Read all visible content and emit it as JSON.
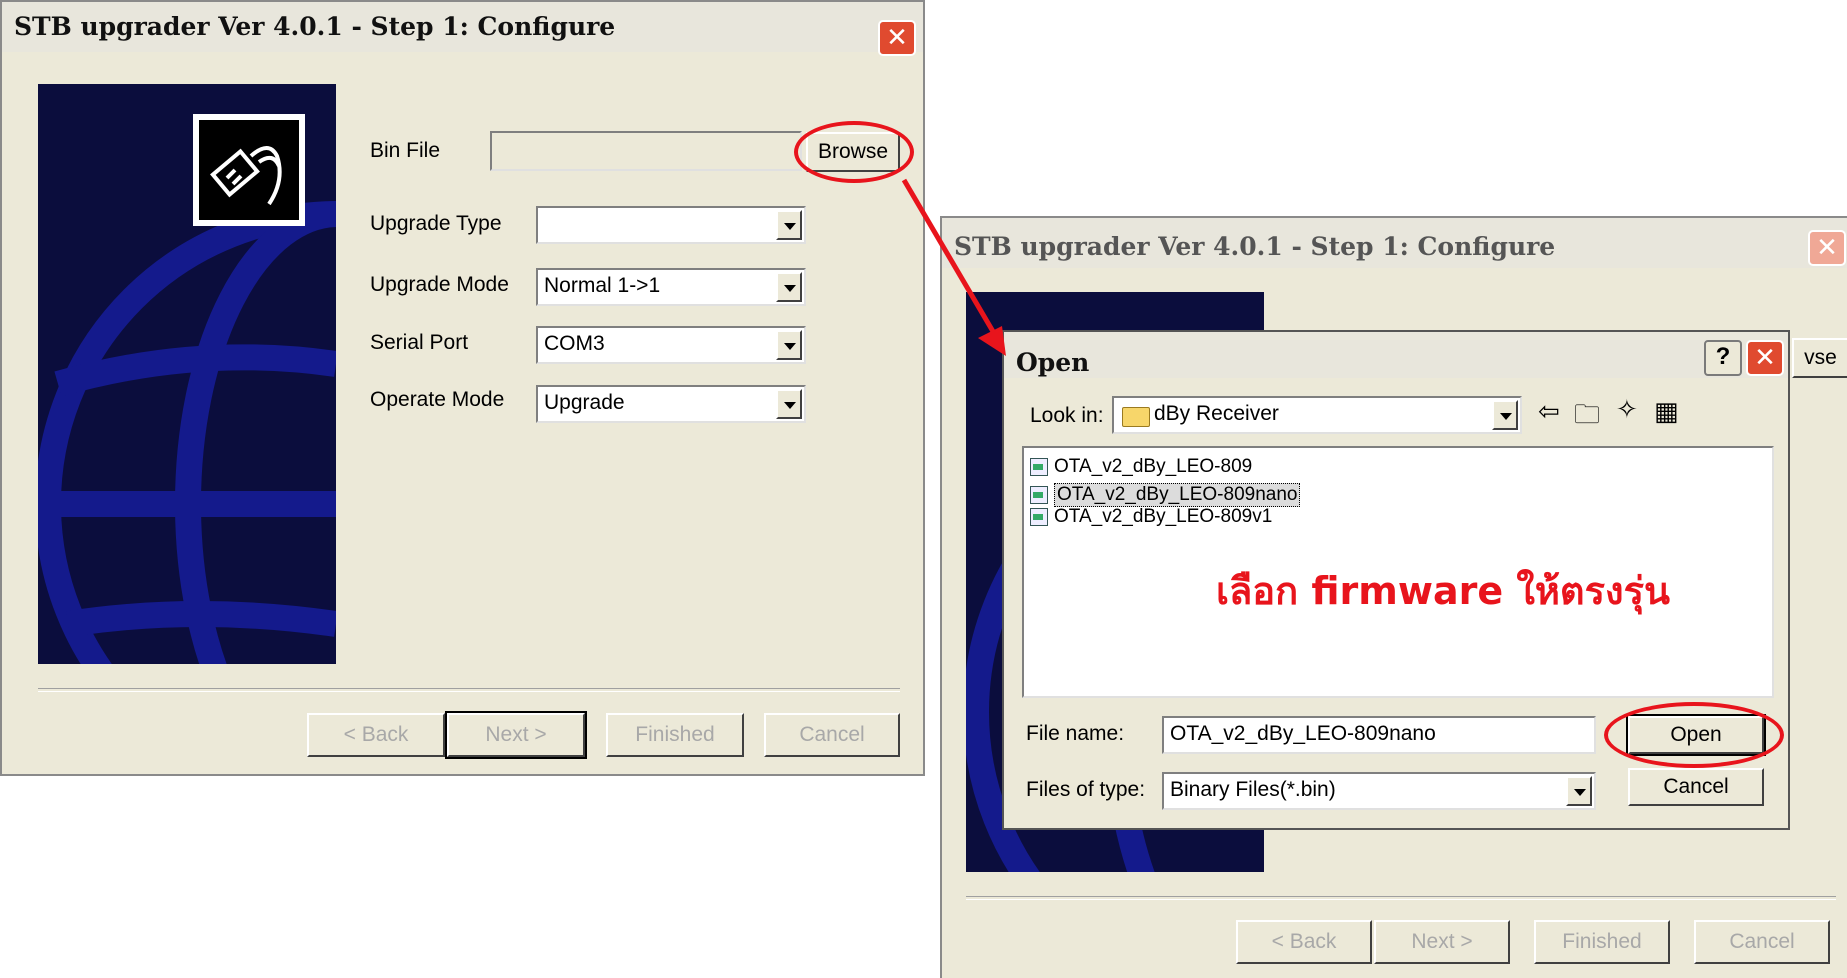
{
  "window1": {
    "title": "STB upgrader Ver 4.0.1 - Step 1: Configure",
    "close_glyph": "✕",
    "bin_file_label": "Bin File",
    "bin_file_value": "",
    "browse_label": "Browse",
    "upgrade_type_label": "Upgrade Type",
    "upgrade_type_value": "",
    "upgrade_mode_label": "Upgrade Mode",
    "upgrade_mode_value": "Normal 1->1",
    "serial_port_label": "Serial Port",
    "serial_port_value": "COM3",
    "operate_mode_label": "Operate Mode",
    "operate_mode_value": "Upgrade",
    "back_label": "< Back",
    "next_label": "Next >",
    "finished_label": "Finished",
    "cancel_label": "Cancel"
  },
  "window2": {
    "title": "STB upgrader Ver 4.0.1 - Step 1: Configure",
    "close_glyph": "✕",
    "browse_partial": "vse",
    "back_label": "< Back",
    "next_label": "Next >",
    "finished_label": "Finished",
    "cancel_label": "Cancel"
  },
  "open_dialog": {
    "title": "Open",
    "help_glyph": "?",
    "close_glyph": "✕",
    "look_in_label": "Look in:",
    "look_in_value": "dBy Receiver",
    "files": [
      {
        "name": "OTA_v2_dBy_LEO-809",
        "selected": false
      },
      {
        "name": "OTA_v2_dBy_LEO-809nano",
        "selected": true
      },
      {
        "name": "OTA_v2_dBy_LEO-809v1",
        "selected": false
      }
    ],
    "file_name_label": "File name:",
    "file_name_value": "OTA_v2_dBy_LEO-809nano",
    "files_of_type_label": "Files of type:",
    "files_of_type_value": "Binary Files(*.bin)",
    "open_label": "Open",
    "cancel_label": "Cancel",
    "toolbar_icons": [
      "back-arrow-icon",
      "up-folder-icon",
      "new-folder-icon",
      "view-menu-icon"
    ]
  },
  "annotation": {
    "caption": "เลือก firmware ให้ตรงรุ่น",
    "color": "#e8141c"
  }
}
